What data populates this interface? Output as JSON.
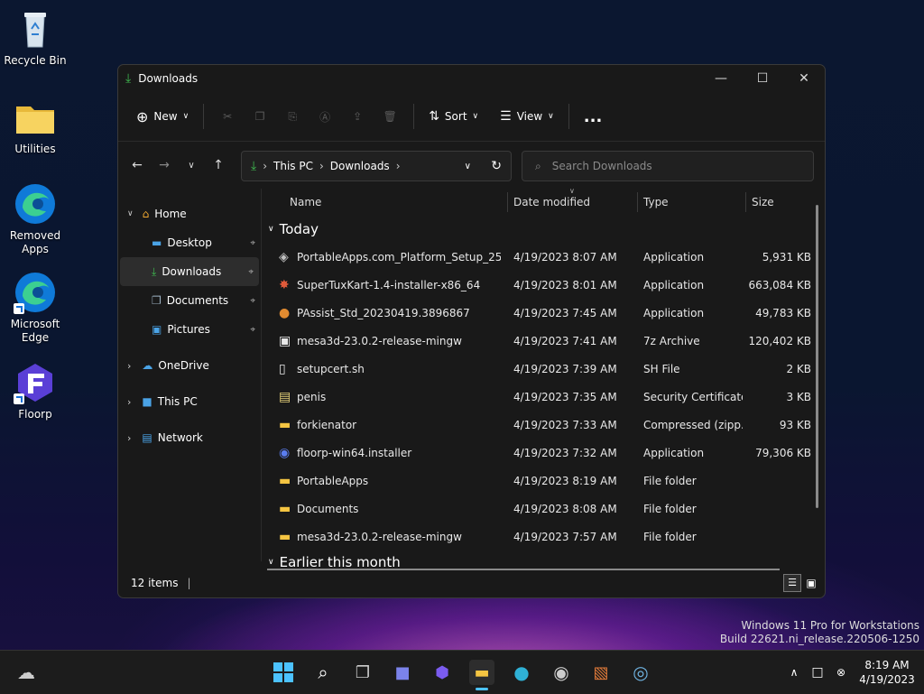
{
  "desktop": {
    "icons": [
      {
        "label": "Recycle Bin"
      },
      {
        "label": "Utilities"
      },
      {
        "label": "Removed Apps"
      },
      {
        "label": "Microsoft Edge"
      },
      {
        "label": "Floorp"
      }
    ],
    "watermark_line1": "Windows 11 Pro for Workstations",
    "watermark_line2": "Build 22621.ni_release.220506-1250"
  },
  "window": {
    "title": "Downloads",
    "toolbar": {
      "new_label": "New",
      "sort_label": "Sort",
      "view_label": "View",
      "more_label": "..."
    },
    "address": {
      "crumb1": "This PC",
      "crumb2": "Downloads"
    },
    "search_placeholder": "Search Downloads",
    "sidebar": {
      "home": "Home",
      "desktop": "Desktop",
      "downloads": "Downloads",
      "documents": "Documents",
      "pictures": "Pictures",
      "onedrive": "OneDrive",
      "thispc": "This PC",
      "network": "Network"
    },
    "columns": {
      "name": "Name",
      "date": "Date modified",
      "type": "Type",
      "size": "Size"
    },
    "group_today": "Today",
    "group_earlier": "Earlier this month",
    "files": [
      {
        "name": "PortableApps.com_Platform_Setup_25.0....",
        "date": "4/19/2023 8:07 AM",
        "type": "Application",
        "size": "5,931 KB",
        "icon": "portableapps-setup-icon"
      },
      {
        "name": "SuperTuxKart-1.4-installer-x86_64",
        "date": "4/19/2023 8:01 AM",
        "type": "Application",
        "size": "663,084 KB",
        "icon": "supertuxkart-icon"
      },
      {
        "name": "PAssist_Std_20230419.3896867",
        "date": "4/19/2023 7:45 AM",
        "type": "Application",
        "size": "49,783 KB",
        "icon": "passist-icon"
      },
      {
        "name": "mesa3d-23.0.2-release-mingw",
        "date": "4/19/2023 7:41 AM",
        "type": "7z Archive",
        "size": "120,402 KB",
        "icon": "7z-archive-icon"
      },
      {
        "name": "setupcert.sh",
        "date": "4/19/2023 7:39 AM",
        "type": "SH File",
        "size": "2 KB",
        "icon": "file-icon"
      },
      {
        "name": "penis",
        "date": "4/19/2023 7:35 AM",
        "type": "Security Certificate",
        "size": "3 KB",
        "icon": "certificate-icon"
      },
      {
        "name": "forkienator",
        "date": "4/19/2023 7:33 AM",
        "type": "Compressed (zipp...",
        "size": "93 KB",
        "icon": "zip-folder-icon"
      },
      {
        "name": "floorp-win64.installer",
        "date": "4/19/2023 7:32 AM",
        "type": "Application",
        "size": "79,306 KB",
        "icon": "floorp-icon"
      },
      {
        "name": "PortableApps",
        "date": "4/19/2023 8:19 AM",
        "type": "File folder",
        "size": "",
        "icon": "folder-icon"
      },
      {
        "name": "Documents",
        "date": "4/19/2023 8:08 AM",
        "type": "File folder",
        "size": "",
        "icon": "folder-icon"
      },
      {
        "name": "mesa3d-23.0.2-release-mingw",
        "date": "4/19/2023 7:57 AM",
        "type": "File folder",
        "size": "",
        "icon": "folder-icon"
      }
    ],
    "status_items": "12 items"
  },
  "taskbar": {
    "time": "8:19 AM",
    "date": "4/19/2023"
  },
  "colors": {
    "accent": "#4cc2ff",
    "folder": "#f5c542",
    "green_arrow": "#3fb950"
  }
}
